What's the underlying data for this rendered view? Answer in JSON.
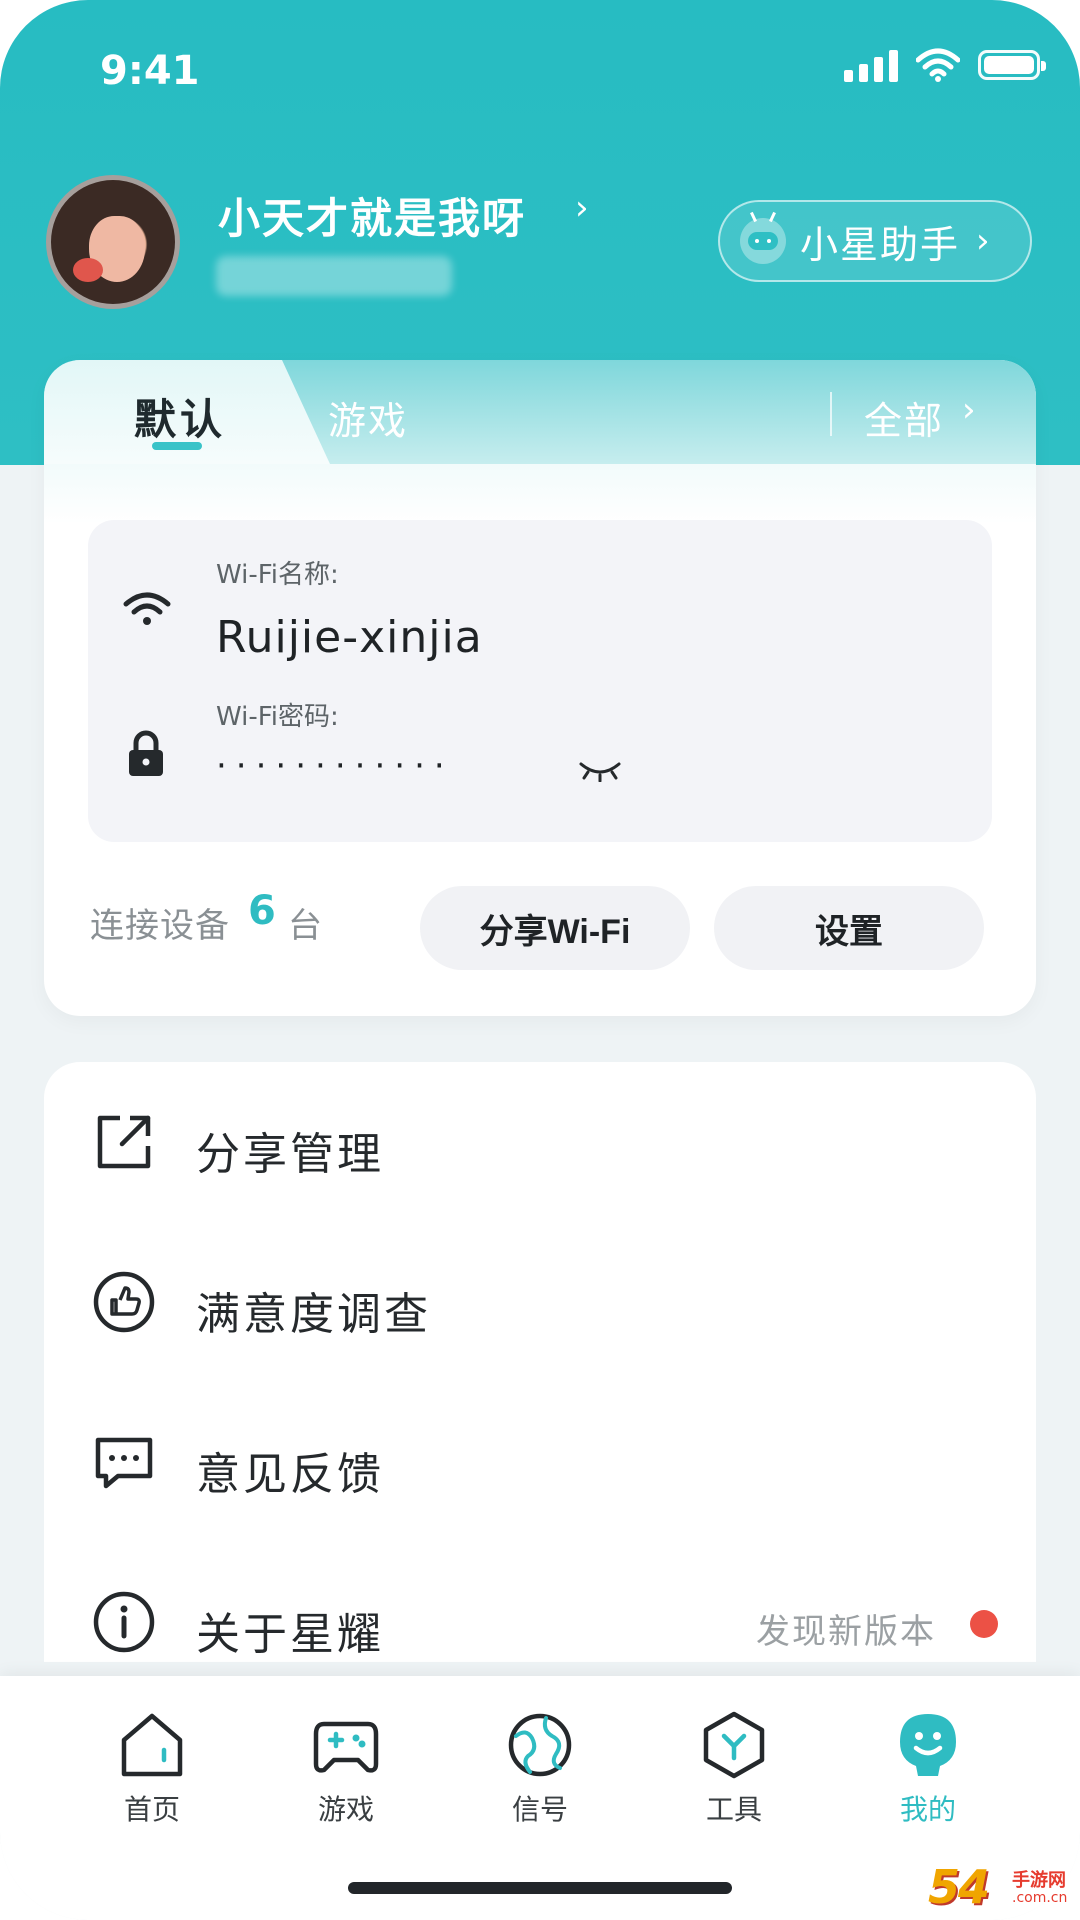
{
  "status_bar": {
    "time": "9:41"
  },
  "profile": {
    "username": "小天才就是我呀",
    "chevron": "›"
  },
  "assistant": {
    "label": "小星助手",
    "chevron": "›"
  },
  "wifi_card": {
    "tabs": {
      "default": "默认",
      "game": "游戏",
      "all": "全部",
      "all_chevron": "›"
    },
    "name_label": "Wi-Fi名称:",
    "name_value": "Ruijie-xinjia",
    "password_label": "Wi-Fi密码:",
    "password_value": "············",
    "devices_prefix": "连接设备",
    "devices_count": "6",
    "devices_unit": "台",
    "share_button": "分享Wi-Fi",
    "settings_button": "设置"
  },
  "menu": {
    "items": [
      {
        "label": "分享管理",
        "icon": "share-icon"
      },
      {
        "label": "满意度调查",
        "icon": "thumbs-up-icon"
      },
      {
        "label": "意见反馈",
        "icon": "chat-bubble-icon"
      },
      {
        "label": "关于星耀",
        "icon": "info-icon",
        "note": "发现新版本"
      }
    ]
  },
  "bottom_nav": {
    "items": [
      {
        "label": "首页",
        "icon": "home-icon"
      },
      {
        "label": "游戏",
        "icon": "gamepad-icon"
      },
      {
        "label": "信号",
        "icon": "signal-globe-icon"
      },
      {
        "label": "工具",
        "icon": "tools-icon"
      },
      {
        "label": "我的",
        "icon": "profile-face-icon",
        "active": true
      }
    ]
  },
  "watermark": {
    "number": "54",
    "text": "手游网",
    "sub": ".com.cn"
  },
  "colors": {
    "accent": "#2fbcc2",
    "header": "#27bcc2",
    "badge_red": "#ec5145"
  }
}
